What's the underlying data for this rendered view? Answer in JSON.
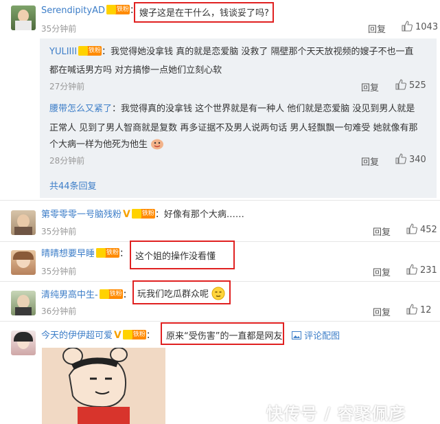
{
  "comments": [
    {
      "username": "SerendipityAD",
      "fan_badge": "铁粉",
      "text": "嫂子这是在干什么，钱谈妥了吗?",
      "time": "35分钟前",
      "reply_label": "回复",
      "likes": "1043",
      "replies": [
        {
          "username": "YULIIII",
          "fan_badge": "铁粉",
          "text_line1": "我觉得她没拿钱 真的就是恋爱脑 没救了 隔壁那个天天放视频的嫂子不也一直",
          "text_line2": "都在喊话男方吗 对方搞惨一点她们立刻心软",
          "time": "27分钟前",
          "reply_label": "回复",
          "likes": "525"
        },
        {
          "username": "腰带怎么又紧了",
          "text_line1": "我觉得真的没拿钱 这个世界就是有一种人 他们就是恋爱脑 没见到男人就是",
          "text_line2": "正常人 见到了男人智商就是复数 再多证据不及男人说两句话 男人轻飘飘一句难受 她就像有那",
          "text_line3": "个大病一样为他死为他生",
          "time": "28分钟前",
          "reply_label": "回复",
          "likes": "340"
        }
      ],
      "total_replies": "共44条回复"
    },
    {
      "username": "第零零零一号脑残粉",
      "fan_badge": "铁粉",
      "text": "好像有那个大病……",
      "time": "35分钟前",
      "reply_label": "回复",
      "likes": "452"
    },
    {
      "username": "晴晴想要早睡",
      "fan_badge": "铁粉",
      "text": "这个姐的操作没看懂",
      "time": "35分钟前",
      "reply_label": "回复",
      "likes": "231"
    },
    {
      "username": "清纯男高中生-",
      "fan_badge": "铁粉",
      "text": "玩我们吃瓜群众呢",
      "time": "36分钟前",
      "reply_label": "回复",
      "likes": "12"
    },
    {
      "username": "今天的伊伊超可爱",
      "fan_badge": "铁粉",
      "text": "原来“受伤害”的一直都是网友",
      "image_link": "评论配图"
    }
  ],
  "watermark": "快传号 / 睿聚佩彦",
  "colors": {
    "link": "#3d7ec8",
    "highlight_border": "#e02020",
    "reply_bg": "#eef1f4",
    "badge": "#ff8a00"
  }
}
